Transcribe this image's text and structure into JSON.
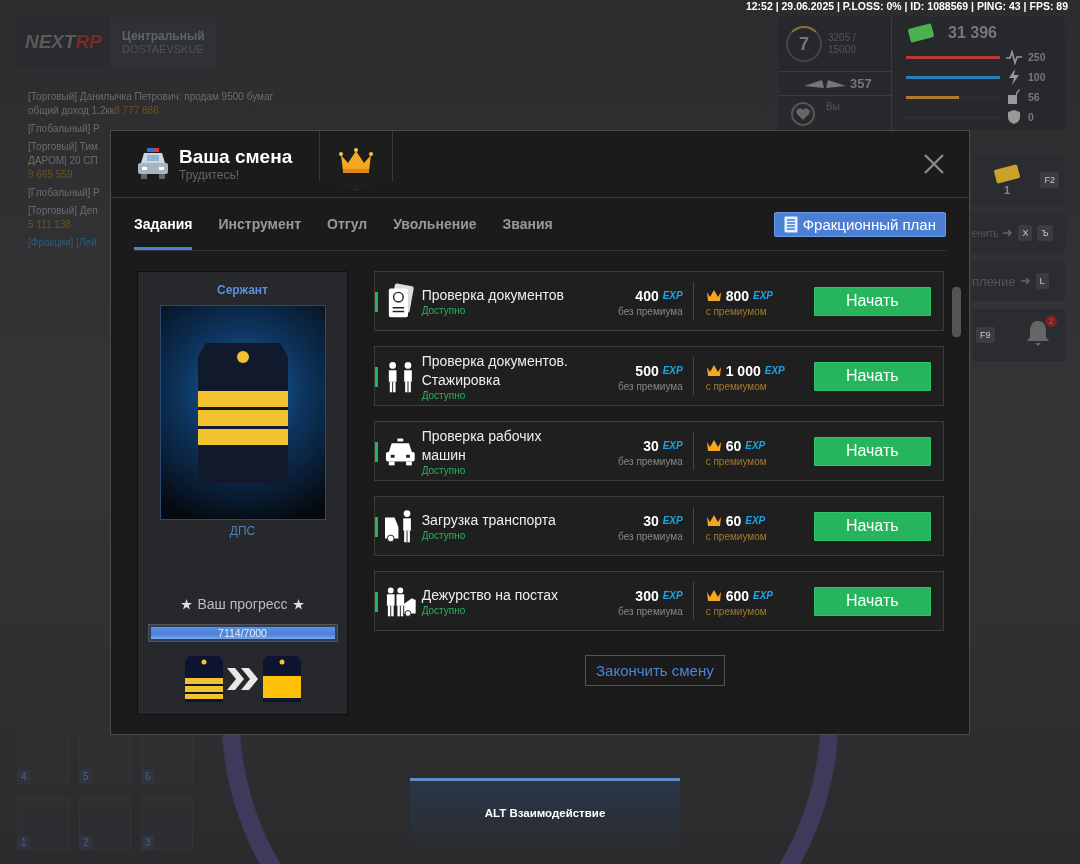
{
  "status_line": "12:52 | 29.06.2025 | P.LOSS: 0% | ID: 1088569 | PING: 43 | FPS: 89",
  "logo": {
    "left": "NEXT",
    "right": "RP"
  },
  "server": {
    "name": "Центральный",
    "city": "DOSTAEVSKUE"
  },
  "chat": [
    {
      "kind": "trade",
      "lines": [
        "[Торговый] Данилычка Петрович: продам 9500 бумаг",
        "общий доход 1.2кк"
      ],
      "amount": "8 777 888",
      "amount_inline": true
    },
    {
      "kind": "global",
      "lines": [
        "[Глобальный] Р"
      ]
    },
    {
      "kind": "trade",
      "lines": [
        "[Торговый] Тим",
        "ДАРОМ| 20 СП"
      ],
      "amount": "9 665 559",
      "amount_inline": false
    },
    {
      "kind": "global",
      "lines": [
        "[Глобальный] Р"
      ]
    },
    {
      "kind": "trade",
      "lines": [
        "[Торговый] Деп"
      ],
      "amount": "5 111 138",
      "amount_inline": false
    },
    {
      "kind": "faction",
      "lines": [
        "[Фракция] [Лей"
      ]
    }
  ],
  "hud": {
    "level": "7",
    "xp": "3205 /",
    "xp_max": "15000",
    "wings": "357",
    "partner_label": "Вы",
    "money": "31 396",
    "stats": [
      {
        "kind": "pulse",
        "value": "250",
        "level": 1,
        "color": "#b83a36"
      },
      {
        "kind": "bolt",
        "value": "100",
        "level": 1,
        "color": "#2a7fb5"
      },
      {
        "kind": "food",
        "value": "56",
        "level": 0.56,
        "color": "#b07a2a"
      },
      {
        "kind": "armor",
        "value": "0"
      }
    ]
  },
  "side_panels": [
    {
      "kind": "cash",
      "count": "1",
      "key": "F2"
    },
    {
      "kind": "action",
      "label": "енить",
      "keys": [
        "X",
        "Ъ"
      ]
    },
    {
      "kind": "action",
      "label": "пление",
      "keys": [
        "L"
      ]
    },
    {
      "kind": "notify",
      "key": "F9",
      "badge": "2"
    }
  ],
  "inventory": [
    "4",
    "5",
    "6",
    "1",
    "2",
    "3"
  ],
  "interaction": "ALT Взаимодействие",
  "dialog": {
    "title": "Ваша смена",
    "subtitle": "Трудитесь!",
    "tabs": [
      {
        "label": "Задания",
        "selected": true
      },
      {
        "label": "Инструмент",
        "selected": false
      },
      {
        "label": "Отгул",
        "selected": false
      },
      {
        "label": "Увольнение",
        "selected": false
      },
      {
        "label": "Звания",
        "selected": false
      }
    ],
    "plan_button": "Фракционный план",
    "rank": {
      "title": "Сержант",
      "unit": "ДПС",
      "progress_label": "Ваш прогресс",
      "progress_text": "7114/7000",
      "level": 1
    },
    "tasks": [
      {
        "kind": "passport",
        "title": "Проверка документов",
        "status": "Доступно",
        "base_exp": "400",
        "base_unit": "EXP",
        "base_label": "без премиума",
        "premium_exp": "800",
        "premium_unit": "EXP",
        "premium_label": "с премиумом",
        "button": "Начать"
      },
      {
        "kind": "officers",
        "title": "Проверка документов. Стажировка",
        "status": "Доступно",
        "base_exp": "500",
        "base_unit": "EXP",
        "base_label": "без премиума",
        "premium_exp": "1 000",
        "premium_unit": "EXP",
        "premium_label": "с премиумом",
        "button": "Начать"
      },
      {
        "kind": "car",
        "title": "Проверка рабочих машин",
        "status": "Доступно",
        "base_exp": "30",
        "base_unit": "EXP",
        "base_label": "без премиума",
        "premium_exp": "60",
        "premium_unit": "EXP",
        "premium_label": "с премиумом",
        "button": "Начать"
      },
      {
        "kind": "loading",
        "title": "Загрузка транспорта",
        "status": "Доступно",
        "base_exp": "30",
        "base_unit": "EXP",
        "base_label": "без премиума",
        "premium_exp": "60",
        "premium_unit": "EXP",
        "premium_label": "с премиумом",
        "button": "Начать"
      },
      {
        "kind": "post",
        "title": "Дежурство на постах",
        "status": "Доступно",
        "base_exp": "300",
        "base_unit": "EXP",
        "base_label": "без премиума",
        "premium_exp": "600",
        "premium_unit": "EXP",
        "premium_label": "с премиумом",
        "button": "Начать"
      }
    ],
    "end_button": "Закончить смену"
  }
}
